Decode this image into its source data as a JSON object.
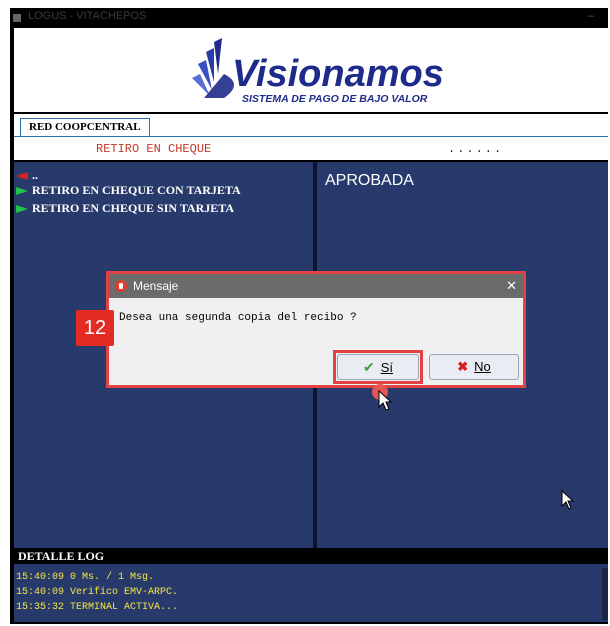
{
  "window": {
    "title": "LOGUS - VITACHEPOS"
  },
  "banner": {
    "logo_name": "Visionamos",
    "logo_tagline": "SISTEMA DE PAGO DE BAJO VALOR"
  },
  "tabs": [
    {
      "label": "RED COOPCENTRAL"
    }
  ],
  "header": {
    "title": "RETIRO EN CHEQUE",
    "dots": "......"
  },
  "left_menu": {
    "back_item": "..",
    "items": [
      {
        "label": "RETIRO EN CHEQUE CON TARJETA"
      },
      {
        "label": "RETIRO EN CHEQUE SIN TARJETA"
      }
    ]
  },
  "right_panel": {
    "status": "APROBADA"
  },
  "log": {
    "header": "DETALLE LOG",
    "lines": [
      "15:40:09 0 Ms. / 1 Msg.",
      "15:40:09 Verifico EMV-ARPC.",
      "15:35:32 TERMINAL ACTIVA..."
    ]
  },
  "dialog": {
    "title": "Mensaje",
    "message": "Desea una segunda copia del recibo ?",
    "yes_label": "Sí",
    "no_label": "No"
  },
  "annotation": {
    "step_number": "12"
  },
  "colors": {
    "panel": "#283a6b",
    "highlight": "#e34242",
    "log_text": "#f5e642",
    "header_title": "#c0392b"
  }
}
